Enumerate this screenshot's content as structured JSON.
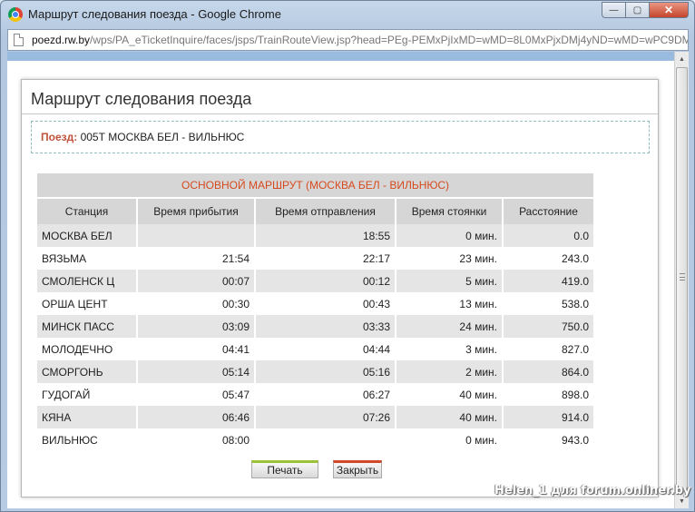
{
  "window": {
    "title": "Маршрут следования поезда - Google Chrome",
    "buttons": {
      "minimize": "—",
      "maximize": "▢",
      "close": "✕"
    }
  },
  "address": {
    "host": "poezd.rw.by",
    "path": "/wps/PA_eTicketInquire/faces/jsps/TrainRouteView.jsp?head=PEg-PEMxPjIxMD=wMD=8L0MxPjxDMj4yND=wMD=wPC9DM"
  },
  "dialog": {
    "title": "Маршрут следования поезда",
    "train_label": "Поезд:",
    "train_value": "005Т МОСКВА БЕЛ - ВИЛЬНЮС"
  },
  "route": {
    "caption": "ОСНОВНОЙ МАРШРУТ (МОСКВА БЕЛ - ВИЛЬНЮС)",
    "columns": [
      "Станция",
      "Время прибытия",
      "Время отправления",
      "Время стоянки",
      "Расстояние"
    ],
    "rows": [
      [
        "МОСКВА БЕЛ",
        "",
        "18:55",
        "0 мин.",
        "0.0"
      ],
      [
        "ВЯЗЬМА",
        "21:54",
        "22:17",
        "23 мин.",
        "243.0"
      ],
      [
        "СМОЛЕНСК Ц",
        "00:07",
        "00:12",
        "5 мин.",
        "419.0"
      ],
      [
        "ОРША ЦЕНТ",
        "00:30",
        "00:43",
        "13 мин.",
        "538.0"
      ],
      [
        "МИНСК ПАСС",
        "03:09",
        "03:33",
        "24 мин.",
        "750.0"
      ],
      [
        "МОЛОДЕЧНО",
        "04:41",
        "04:44",
        "3 мин.",
        "827.0"
      ],
      [
        "СМОРГОНЬ",
        "05:14",
        "05:16",
        "2 мин.",
        "864.0"
      ],
      [
        "ГУДОГАЙ",
        "05:47",
        "06:27",
        "40 мин.",
        "898.0"
      ],
      [
        "КЯНА",
        "06:46",
        "07:26",
        "40 мин.",
        "914.0"
      ],
      [
        "ВИЛЬНЮС",
        "08:00",
        "",
        "0 мин.",
        "943.0"
      ]
    ]
  },
  "buttons": {
    "print": "Печать",
    "close": "Закрыть"
  },
  "watermark": "Helen_1 для forum.onliner.by",
  "colors": {
    "accent": "#d64a1e",
    "train_label": "#c0513a",
    "print_bar": "#9cc23a",
    "close_bar": "#cf4a2a"
  }
}
